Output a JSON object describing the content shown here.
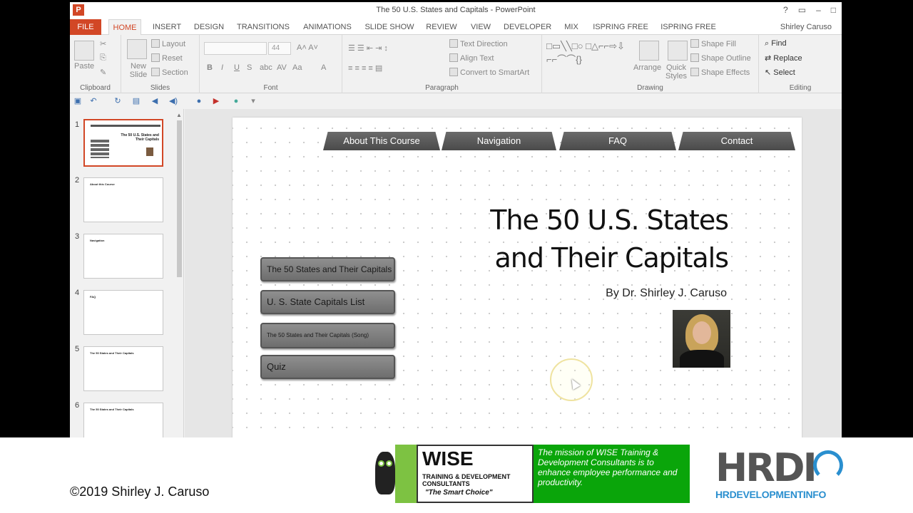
{
  "window": {
    "title": "The 50 U.S. States and Capitals - PowerPoint",
    "user": "Shirley Caruso"
  },
  "tabs": [
    "FILE",
    "HOME",
    "INSERT",
    "DESIGN",
    "TRANSITIONS",
    "ANIMATIONS",
    "SLIDE SHOW",
    "REVIEW",
    "VIEW",
    "DEVELOPER",
    "MIX",
    "ISPRING FREE 7",
    "ISPRING FREE 8"
  ],
  "ribbon": {
    "clipboard": {
      "label": "Clipboard",
      "paste": "Paste"
    },
    "slides": {
      "label": "Slides",
      "new_slide": "New Slide",
      "layout": "Layout",
      "reset": "Reset",
      "section": "Section"
    },
    "font": {
      "label": "Font",
      "size": "44"
    },
    "paragraph": {
      "label": "Paragraph",
      "text_direction": "Text Direction",
      "align_text": "Align Text",
      "convert": "Convert to SmartArt"
    },
    "drawing": {
      "label": "Drawing",
      "arrange": "Arrange",
      "quick_styles": "Quick Styles",
      "shape_fill": "Shape Fill",
      "shape_outline": "Shape Outline",
      "shape_effects": "Shape Effects"
    },
    "editing": {
      "label": "Editing",
      "find": "Find",
      "replace": "Replace",
      "select": "Select"
    }
  },
  "thumbnails": [
    {
      "num": "1",
      "text": "The 50 U.S. States and Their Capitals"
    },
    {
      "num": "2",
      "text": "About this Course"
    },
    {
      "num": "3",
      "text": "Navigation"
    },
    {
      "num": "4",
      "text": "FAQ"
    },
    {
      "num": "5",
      "text": "The 50 States and Their Capitals"
    },
    {
      "num": "6",
      "text": "The 50 States and Their Capitals"
    }
  ],
  "slide": {
    "nav": [
      "About This Course",
      "Navigation",
      "FAQ",
      "Contact"
    ],
    "title_line1": "The 50 U.S. States",
    "title_line2": "and Their Capitals",
    "author": "By Dr. Shirley J. Caruso",
    "buttons": [
      "The 50 States and Their Capitals",
      "U. S. State Capitals List",
      "The 50 States and Their Capitals (Song)",
      "Quiz"
    ]
  },
  "footer": {
    "copyright": "©2019 Shirley J. Caruso",
    "wise_name": "WISE",
    "wise_sub_line1": "TRAINING & DEVELOPMENT",
    "wise_sub_line2": "CONSULTANTS",
    "wise_slogan": "\"The Smart Choice\"",
    "wise_mission": "The mission of WISE Training & Development Consultants is to enhance employee performance and productivity.",
    "hrdi_logo": "HRDI",
    "hrdi_text": "HRDEVELOPMENTINFO"
  },
  "colors": {
    "accent": "#d24726",
    "wise_green": "#0aa50a",
    "hrdi_blue": "#2a8fcf"
  }
}
